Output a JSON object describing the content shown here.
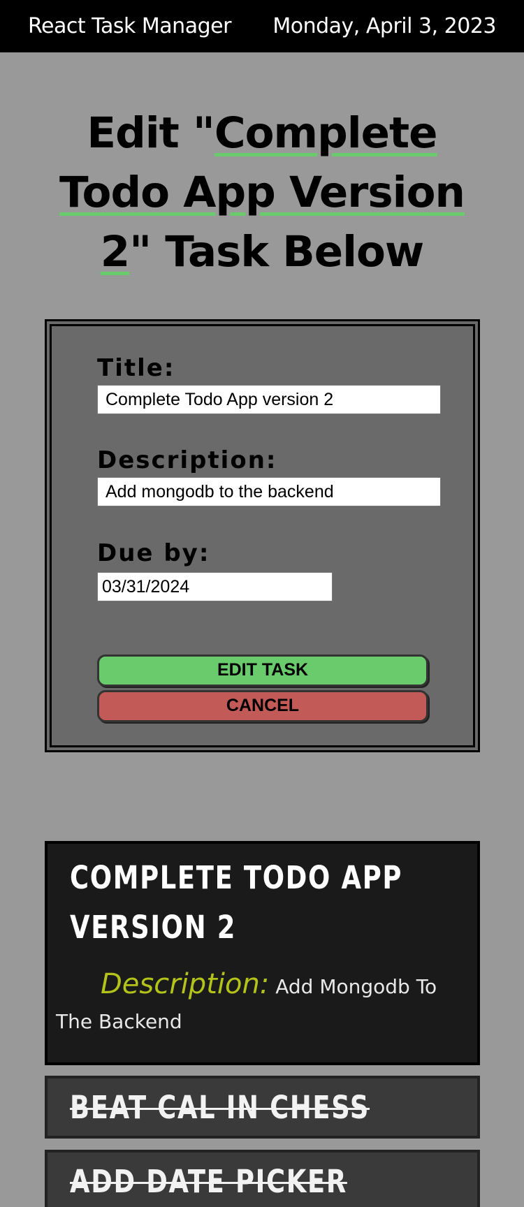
{
  "topbar": {
    "app_name": "React Task Manager",
    "date": "Monday, April 3, 2023"
  },
  "heading": {
    "prefix": "Edit \"",
    "task_name": "Complete Todo App Version 2",
    "suffix": "\" Task Below"
  },
  "form": {
    "title_label": "Title:",
    "title_value": "Complete Todo App version 2",
    "description_label": "Description:",
    "description_value": "Add mongodb to the backend",
    "due_label": "Due by:",
    "due_value": "03/31/2024",
    "edit_button": "EDIT TASK",
    "cancel_button": "CANCEL"
  },
  "tasks": [
    {
      "title_line1": "Complete Todo App",
      "title_line2": "Version 2",
      "description_label": "Description:",
      "description": "Add Mongodb To The Backend"
    },
    {
      "title": "Beat Cal In Chess"
    },
    {
      "title": "Add Date Picker"
    }
  ],
  "colors": {
    "background": "#999999",
    "accent_green": "#6acb6d",
    "cancel_red": "#c25a57",
    "description_label": "#b4c31a"
  }
}
